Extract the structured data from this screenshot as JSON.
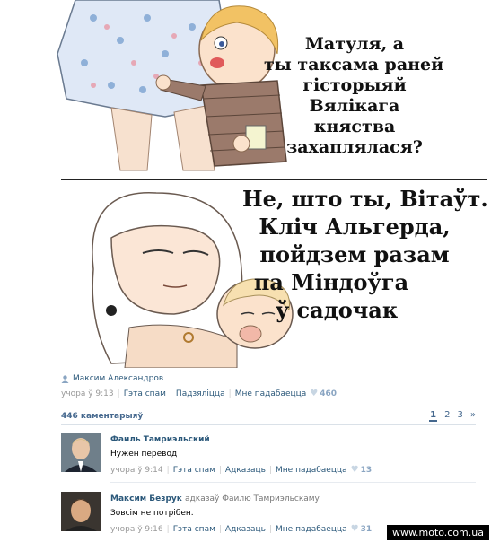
{
  "comic": {
    "panel1_lines": [
      "Матуля, а",
      "ты таксама раней",
      "гісторыяй",
      "Вялікага",
      "княства",
      "захаплялася?"
    ],
    "panel2_lines": [
      "Не, што ты, Вітаўт.",
      "Кліч Альгерда,",
      "пойдзем разам",
      "па Міндоўга",
      "ў садочак"
    ]
  },
  "post": {
    "author": "Максим Александров",
    "time": "учора ў 9:13",
    "actions": [
      "Гэта спам",
      "Падзяліцца",
      "Мне падабаецца"
    ],
    "likes": "460"
  },
  "comments_header": {
    "count": "446 каментарыяў",
    "pages": [
      "1",
      "2",
      "3",
      "»"
    ]
  },
  "comments": [
    {
      "author": "Фаиль Тамриэльский",
      "reply_to": "",
      "text": "Нужен перевод",
      "time": "учора ў 9:14",
      "actions": [
        "Гэта спам",
        "Адказаць",
        "Мне падабаецца"
      ],
      "likes": "13"
    },
    {
      "author": "Максим Безрук",
      "reply_to": "адказаў Фаилю Тамриэльскаму",
      "text": "Зовсім не потрібен.",
      "time": "учора ў 9:16",
      "actions": [
        "Гэта спам",
        "Адказаць",
        "Мне падабаецца"
      ],
      "likes": "31"
    }
  ],
  "watermark": "www.moto.com.ua"
}
